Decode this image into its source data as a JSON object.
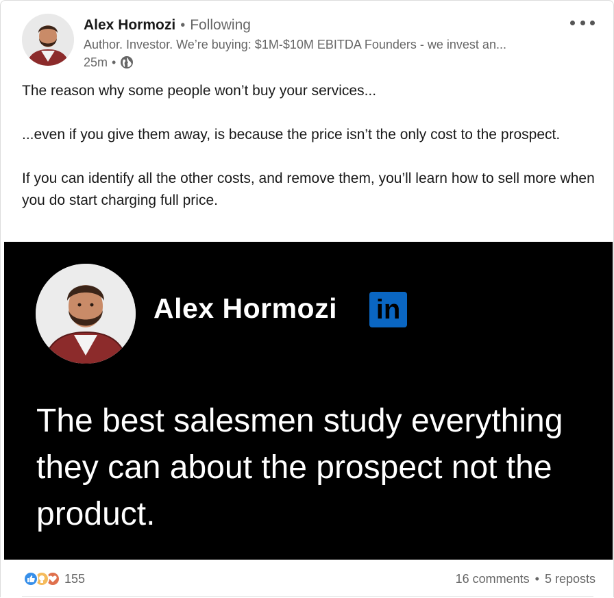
{
  "post": {
    "author": {
      "name": "Alex Hormozi",
      "follow_status": "Following",
      "headline": "Author. Investor. We’re buying: $1M-$10M EBITDA Founders - we invest an...",
      "time_ago": "25m",
      "visibility_icon": "globe-icon"
    },
    "body": {
      "paragraph1": "The reason why some people won’t buy your services...",
      "paragraph2": "...even if you give them away, is because the price isn’t the only cost to the prospect.",
      "paragraph3": "If you can identify all the other costs, and remove them, you’ll learn how to sell more when you do start charging full price."
    },
    "image": {
      "name": "Alex Hormozi",
      "logo_text": "in",
      "quote": "The best salesmen study everything they can about the prospect not the product.",
      "background_color": "#000000",
      "logo_color": "#0a66c2"
    },
    "social": {
      "reaction_icons": [
        "like-icon",
        "insightful-icon",
        "love-icon"
      ],
      "reaction_count": "155",
      "comments": "16 comments",
      "reposts": "5 reposts",
      "separator": "•"
    }
  }
}
